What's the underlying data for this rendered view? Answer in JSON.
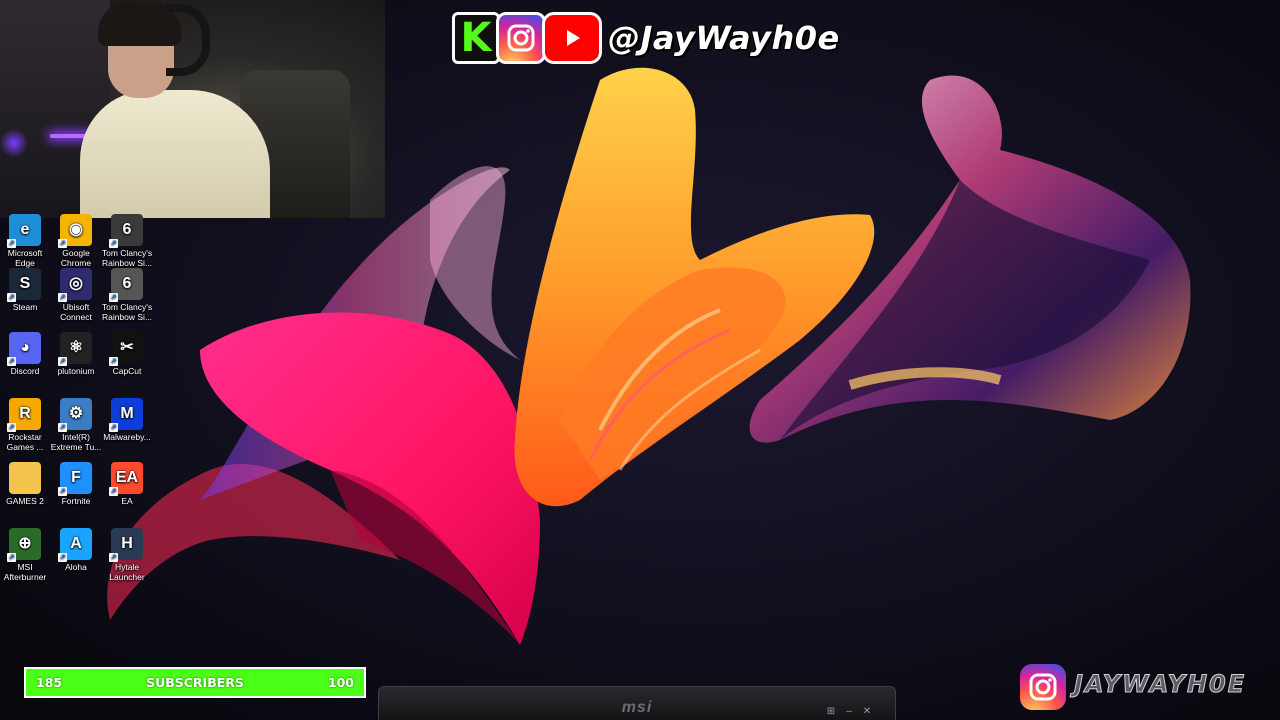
{
  "social": {
    "platforms": [
      "kick-icon",
      "instagram-icon",
      "youtube-icon"
    ],
    "kick_letter": "K",
    "handle": "@JayWayh0e"
  },
  "desktop_icons": [
    {
      "label": "Microsoft Edge",
      "icon": "edge-icon",
      "color": "#1e8fd6"
    },
    {
      "label": "Google Chrome",
      "icon": "chrome-icon",
      "color": "#f4b400"
    },
    {
      "label": "Tom Clancy's Rainbow Si...",
      "icon": "rainbow-six-icon",
      "color": "#3a3a3a"
    },
    {
      "label": "Steam",
      "icon": "steam-icon",
      "color": "#1b2838"
    },
    {
      "label": "Ubisoft Connect",
      "icon": "ubisoft-icon",
      "color": "#2c2c6e"
    },
    {
      "label": "Tom Clancy's Rainbow Si...",
      "icon": "rainbow-six-icon",
      "color": "#555"
    },
    {
      "label": "Discord",
      "icon": "discord-icon",
      "color": "#5865f2"
    },
    {
      "label": "plutonium",
      "icon": "atom-icon",
      "color": "#222"
    },
    {
      "label": "CapCut",
      "icon": "capcut-icon",
      "color": "#111"
    },
    {
      "label": "Rockstar Games ...",
      "icon": "rockstar-icon",
      "color": "#f5a800"
    },
    {
      "label": "Intel(R) Extreme Tu...",
      "icon": "intel-xtu-icon",
      "color": "#3b7cc4"
    },
    {
      "label": "Malwareby...",
      "icon": "malwarebytes-icon",
      "color": "#0d3fd8"
    },
    {
      "label": "GAMES 2",
      "icon": "folder-icon",
      "color": "#f3c54d"
    },
    {
      "label": "Fortnite",
      "icon": "fortnite-icon",
      "color": "#1e90ff"
    },
    {
      "label": "EA",
      "icon": "ea-icon",
      "color": "#ff4a2b"
    },
    {
      "label": "MSI Afterburner",
      "icon": "afterburner-icon",
      "color": "#2a6b2a"
    },
    {
      "label": "Aloha",
      "icon": "aloha-icon",
      "color": "#1aa3ff"
    },
    {
      "label": "Hytale Launcher",
      "icon": "hytale-icon",
      "color": "#2a3a55"
    }
  ],
  "subscriber_goal": {
    "current": "185",
    "label": "SUBSCRIBERS",
    "goal": "100"
  },
  "taskbar": {
    "logo": "msi"
  },
  "footer": {
    "handle": "JAYWAYH0E",
    "icon": "instagram-icon"
  }
}
